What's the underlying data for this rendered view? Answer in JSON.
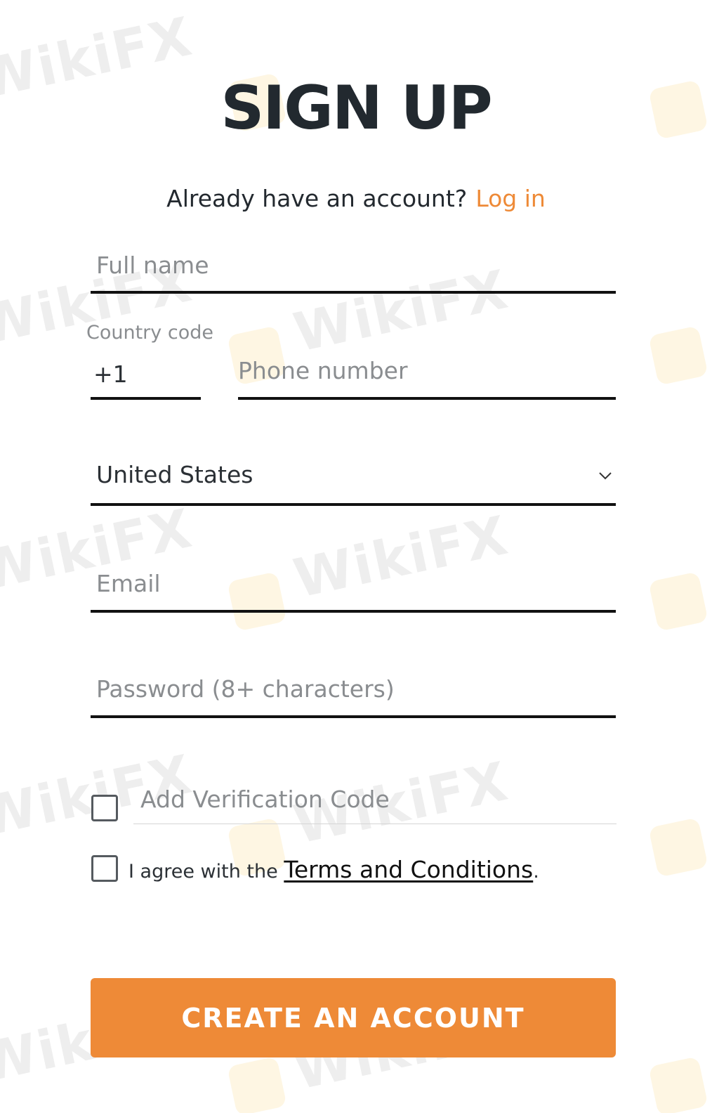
{
  "title": "SIGN UP",
  "login_prompt": {
    "question": "Already have an account?",
    "link_label": "Log in"
  },
  "form": {
    "full_name": {
      "placeholder": "Full name",
      "value": ""
    },
    "country_code": {
      "label": "Country code",
      "value": "+1"
    },
    "phone": {
      "placeholder": "Phone number",
      "value": ""
    },
    "country": {
      "selected": "United States"
    },
    "email": {
      "placeholder": "Email",
      "value": ""
    },
    "password": {
      "placeholder": "Password (8+ characters)",
      "value": ""
    },
    "verification": {
      "label": "Add Verification Code",
      "checked": false
    },
    "terms": {
      "prefix": "I agree with the",
      "link_label": "Terms and Conditions",
      "suffix": ".",
      "checked": false
    },
    "submit_label": "CREATE AN ACCOUNT"
  },
  "watermark": {
    "text": "WikiFX"
  },
  "colors": {
    "accent": "#ee8a37",
    "heading": "#22292f",
    "placeholder": "#8a8d90",
    "underline": "#111111"
  },
  "icons": {
    "select": "chevron-down-icon",
    "watermark_logo": "eagle-logo-icon"
  }
}
